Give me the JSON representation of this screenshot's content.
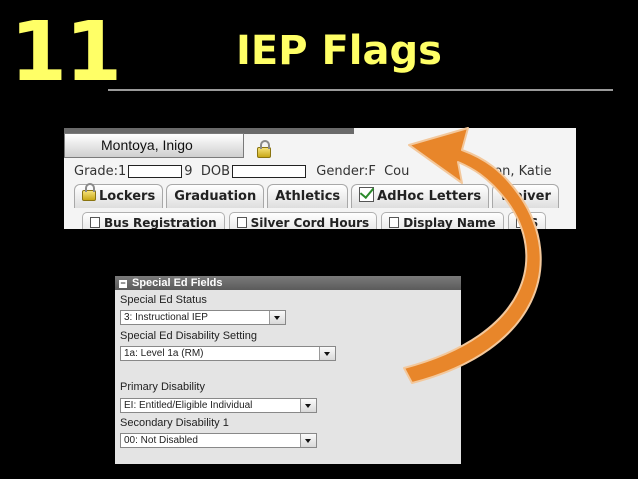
{
  "slide": {
    "number": "11",
    "title": "IEP Flags"
  },
  "header_shot": {
    "student_name": "Montoya, Inigo",
    "grade_label": "Grade:1",
    "grade_tail": "9",
    "dob_label": "DOB",
    "gender_label": "Gender:F",
    "counselor_label": "Cou",
    "counselor_tail": "son, Katie",
    "tabs": [
      {
        "label": "Lockers",
        "icon": "lock-icon"
      },
      {
        "label": "Graduation"
      },
      {
        "label": "Athletics"
      },
      {
        "label": "AdHoc Letters",
        "icon": "adhoc-checklist-icon"
      },
      {
        "label": "Waiver"
      }
    ],
    "subtabs": [
      {
        "label": "Bus Registration",
        "icon": "document-icon"
      },
      {
        "label": "Silver Cord Hours",
        "icon": "document-icon"
      },
      {
        "label": "Display Name",
        "icon": "document-icon"
      },
      {
        "label": "S",
        "icon": "document-icon"
      }
    ]
  },
  "special_ed": {
    "panel_title": "Special Ed Fields",
    "toggle_symbol": "−",
    "fields": [
      {
        "label": "Special Ed Status",
        "value": "3: Instructional IEP"
      },
      {
        "label": "Special Ed Disability Setting",
        "value": "1a: Level 1a (RM)"
      },
      {
        "label": "Primary Disability",
        "value": "EI: Entitled/Eligible Individual"
      },
      {
        "label": "Secondary Disability 1",
        "value": "00: Not Disabled"
      }
    ]
  },
  "colors": {
    "title": "#ffff66",
    "arrow": "#e8862a",
    "background": "#000000"
  }
}
